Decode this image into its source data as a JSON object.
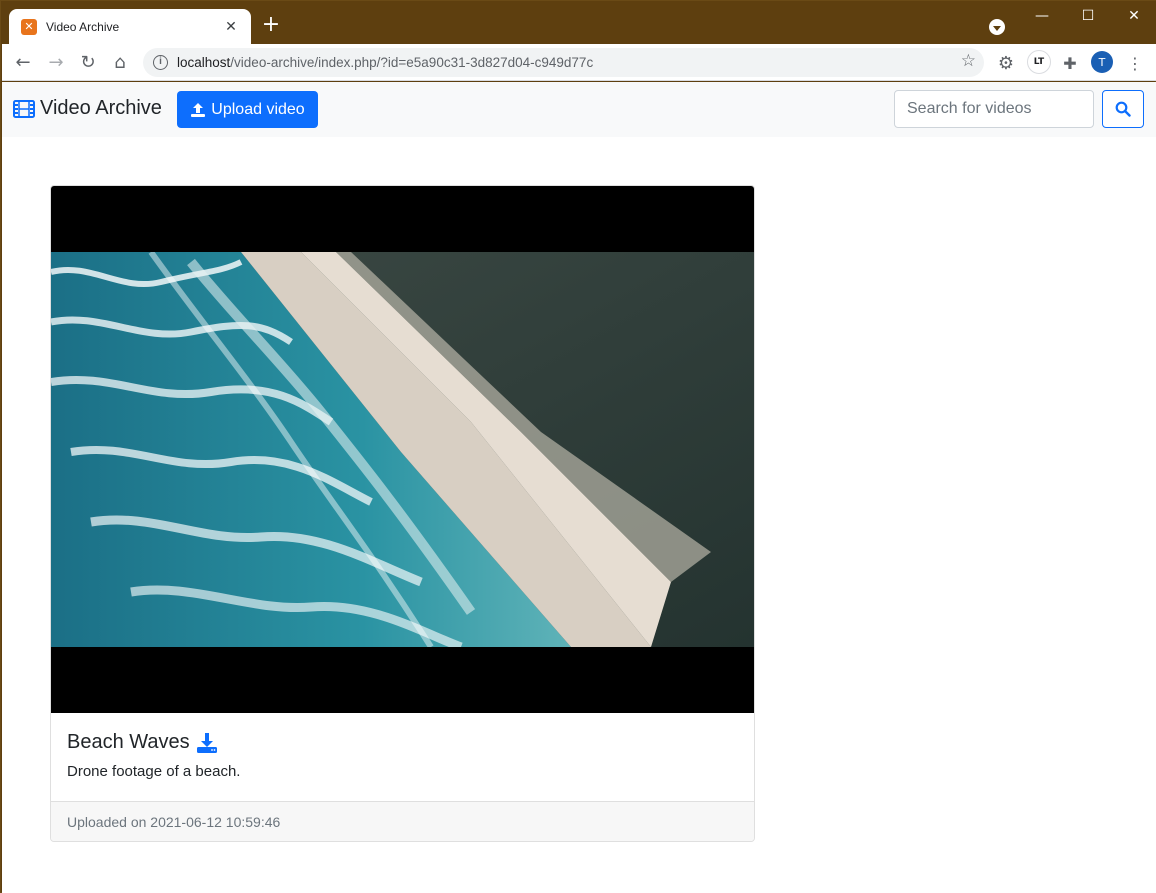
{
  "browser": {
    "tab": {
      "title": "Video Archive",
      "favicon_letter": "✕"
    },
    "address": {
      "host": "localhost",
      "path": "/video-archive/index.php/?id=e5a90c31-3d827d04-c949d77c"
    },
    "avatar_letter": "T",
    "lt_extension_label": "LT"
  },
  "navbar": {
    "brand": "Video Archive",
    "upload_label": "Upload video",
    "search_placeholder": "Search for videos"
  },
  "video": {
    "title": "Beach Waves",
    "description": "Drone footage of a beach.",
    "footer": "Uploaded on 2021-06-12 10:59:46"
  },
  "colors": {
    "primary": "#0d6efd",
    "titlebar": "#5e3f0f"
  }
}
